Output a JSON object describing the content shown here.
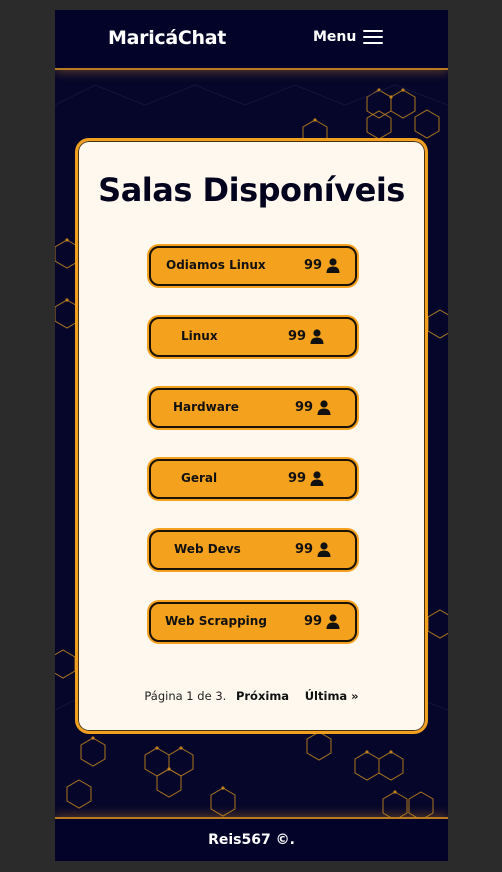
{
  "header": {
    "brand": "MaricáChat",
    "menu_label": "Menu"
  },
  "main": {
    "title": "Salas Disponíveis",
    "rooms": [
      {
        "name": "Odiamos Linux",
        "count": "99"
      },
      {
        "name": "Linux",
        "count": "99"
      },
      {
        "name": "Hardware",
        "count": "99"
      },
      {
        "name": "Geral",
        "count": "99"
      },
      {
        "name": "Web Devs",
        "count": "99"
      },
      {
        "name": "Web Scrapping",
        "count": "99"
      }
    ],
    "pagination": {
      "info": "Página 1 de 3.",
      "next": "Próxima",
      "last": "Última »"
    }
  },
  "footer": {
    "text": "Reis567 ©."
  },
  "colors": {
    "accent": "#f4a11e",
    "background": "#06062a",
    "card": "#fff8ee"
  }
}
